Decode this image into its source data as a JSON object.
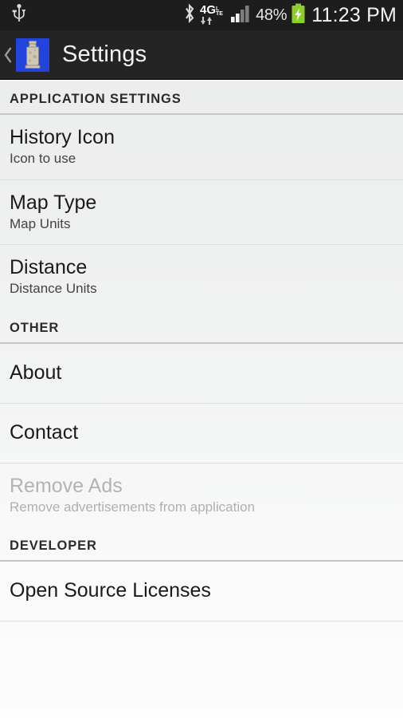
{
  "status_bar": {
    "usb_icon": "usb-icon",
    "bluetooth_icon": "bluetooth-icon",
    "network_label": "4G",
    "network_sub_label": "LTE",
    "battery_percent": "48%",
    "battery_icon": "battery-charging-icon",
    "signal_icon": "signal-bars-icon",
    "clock": "11:23 PM",
    "signal_bars_filled": 2,
    "signal_bars_total": 4
  },
  "action_bar": {
    "back_label": "‹",
    "app_icon": "trophy-icon",
    "title": "Settings",
    "icon_bg": "#2244dd"
  },
  "sections": [
    {
      "header": "APPLICATION SETTINGS",
      "items": [
        {
          "title": "History Icon",
          "subtitle": "Icon to use",
          "disabled": false
        },
        {
          "title": "Map Type",
          "subtitle": "Map Units",
          "disabled": false
        },
        {
          "title": "Distance",
          "subtitle": "Distance Units",
          "disabled": false
        }
      ]
    },
    {
      "header": "OTHER",
      "items": [
        {
          "title": "About",
          "subtitle": "",
          "disabled": false
        },
        {
          "title": "Contact",
          "subtitle": "",
          "disabled": false
        },
        {
          "title": "Remove Ads",
          "subtitle": "Remove advertisements from application",
          "disabled": true
        }
      ]
    },
    {
      "header": "DEVELOPER",
      "items": [
        {
          "title": "Open Source Licenses",
          "subtitle": "",
          "disabled": false
        }
      ]
    }
  ],
  "colors": {
    "status_bar_bg": "#1d1d1d",
    "action_bar_bg": "#242424",
    "battery_green": "#8ccf25",
    "accent_blue": "#2244dd"
  }
}
